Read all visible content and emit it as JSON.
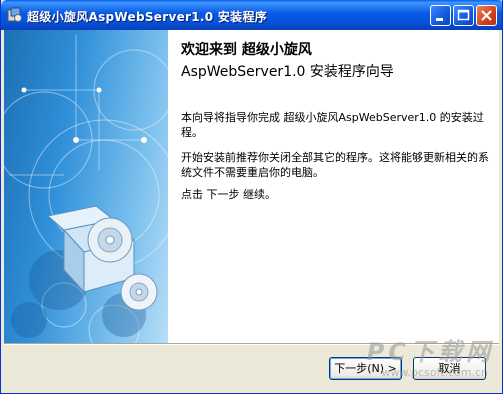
{
  "window": {
    "title": "超级小旋风AspWebServer1.0  安装程序"
  },
  "wizard": {
    "heading_line1": "欢迎来到 超级小旋风",
    "heading_line2": "AspWebServer1.0 安装程序向导",
    "para1": "本向导将指导你完成 超级小旋风AspWebServer1.0 的安装过程。",
    "para2": "开始安装前推荐你关闭全部其它的程序。这将能够更新相关的系统文件不需要重启你的电脑。",
    "para3": "点击 下一步 继续。"
  },
  "buttons": {
    "next": "下一步(N) >",
    "cancel": "取消"
  },
  "watermark": {
    "text": "PC下载网",
    "url": "www.pcsoft.com.cn"
  },
  "colors": {
    "titlebar": "#0a5ce6",
    "banner": "#2f8fd8",
    "face": "#ece9d8"
  }
}
